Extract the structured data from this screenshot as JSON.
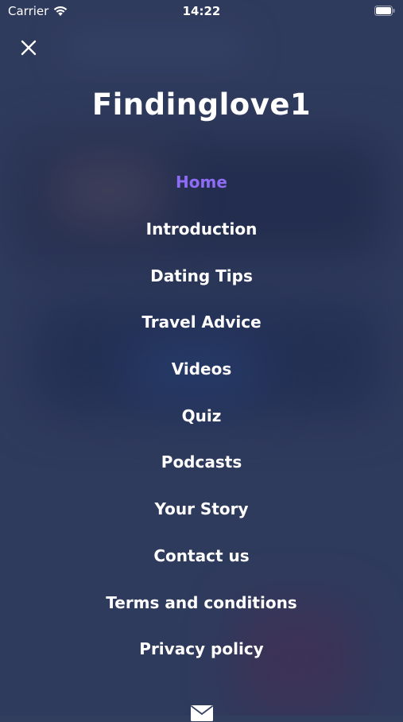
{
  "status_bar": {
    "carrier": "Carrier",
    "time": "14:22",
    "wifi_icon": "wifi-icon",
    "battery_icon": "battery-icon"
  },
  "colors": {
    "background": "#323e5e",
    "text": "#ffffff",
    "active_item": "#8e6cf5"
  },
  "header": {
    "close_icon": "close-icon",
    "title": "Findinglove1"
  },
  "menu": {
    "active_index": 0,
    "items": [
      {
        "label": "Home"
      },
      {
        "label": "Introduction"
      },
      {
        "label": "Dating Tips"
      },
      {
        "label": "Travel Advice"
      },
      {
        "label": "Videos"
      },
      {
        "label": "Quiz"
      },
      {
        "label": "Podcasts"
      },
      {
        "label": "Your Story"
      },
      {
        "label": "Contact us"
      },
      {
        "label": "Terms and conditions"
      },
      {
        "label": "Privacy policy"
      }
    ]
  },
  "footer": {
    "mail_icon": "mail-icon"
  }
}
